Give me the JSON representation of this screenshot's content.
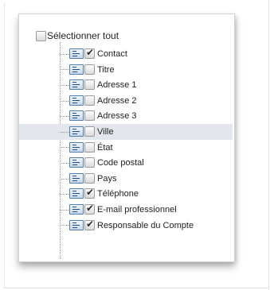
{
  "tree": {
    "select_all": {
      "label": "Sélectionner tout",
      "checked": false
    },
    "items": [
      {
        "label": "Contact",
        "checked": true,
        "selected": false
      },
      {
        "label": "Titre",
        "checked": false,
        "selected": false
      },
      {
        "label": "Adresse 1",
        "checked": false,
        "selected": false
      },
      {
        "label": "Adresse 2",
        "checked": false,
        "selected": false
      },
      {
        "label": "Adresse 3",
        "checked": false,
        "selected": false
      },
      {
        "label": "Ville",
        "checked": false,
        "selected": true
      },
      {
        "label": "État",
        "checked": false,
        "selected": false
      },
      {
        "label": "Code postal",
        "checked": false,
        "selected": false
      },
      {
        "label": "Pays",
        "checked": false,
        "selected": false
      },
      {
        "label": "Téléphone",
        "checked": true,
        "selected": false
      },
      {
        "label": "E-mail professionnel",
        "checked": true,
        "selected": false
      },
      {
        "label": "Responsable du Compte",
        "checked": true,
        "selected": false
      }
    ],
    "item_icon": "field-list-icon",
    "highlight_color": "#e3e6ea"
  }
}
